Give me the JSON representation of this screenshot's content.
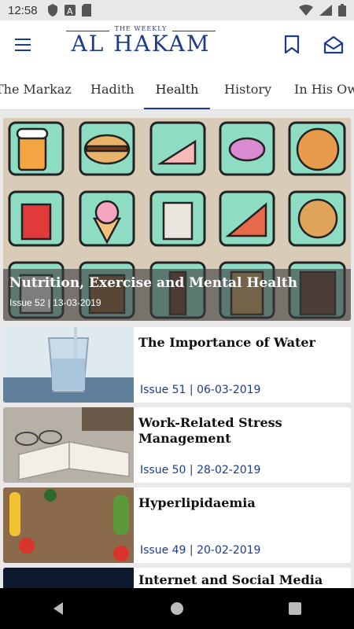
{
  "status": {
    "time": "12:58"
  },
  "header": {
    "logo_top": "THE WEEKLY",
    "logo_title": "AL HAKAM"
  },
  "tabs": [
    {
      "label": "The Markaz"
    },
    {
      "label": "Hadith"
    },
    {
      "label": "Health"
    },
    {
      "label": "History"
    },
    {
      "label": "In His Own"
    }
  ],
  "active_tab": "Health",
  "featured": {
    "title": "Nutrition, Exercise and Mental Health",
    "meta": "Issue 52 | 13-03-2019"
  },
  "articles": [
    {
      "title": "The Importance of Water",
      "meta": "Issue 51 | 06-03-2019"
    },
    {
      "title": "Work-Related Stress Management",
      "meta": "Issue 50 | 28-02-2019"
    },
    {
      "title": "Hyperlipidaemia",
      "meta": "Issue 49 | 20-02-2019"
    },
    {
      "title": "Internet and Social Media",
      "meta": ""
    }
  ],
  "colors": {
    "accent": "#1f3b8c"
  }
}
